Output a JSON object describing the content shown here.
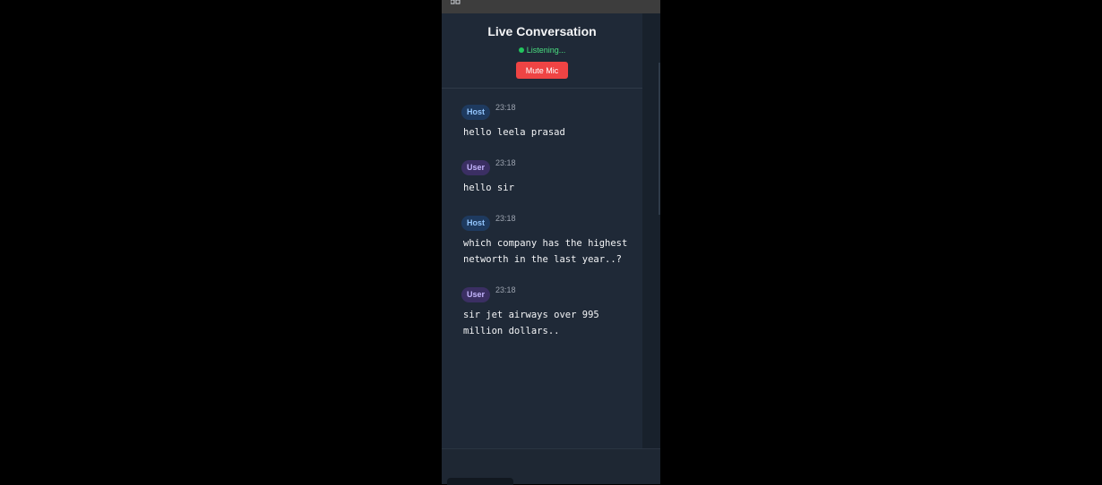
{
  "header": {
    "title": "Live Conversation",
    "status": "Listening...",
    "mute_label": "Mute Mic"
  },
  "colors": {
    "accent_danger": "#ef4444",
    "status_green": "#22c55e",
    "host_badge": "#1e3a5f",
    "user_badge": "#3b2f63"
  },
  "messages": [
    {
      "role": "Host",
      "time": "23:18",
      "text": "hello leela prasad"
    },
    {
      "role": "User",
      "time": "23:18",
      "text": "hello sir"
    },
    {
      "role": "Host",
      "time": "23:18",
      "text": "which company has the highest\nnetworth in the last year..?"
    },
    {
      "role": "User",
      "time": "23:18",
      "text": "sir jet airways over 995\nmillion dollars.."
    }
  ]
}
